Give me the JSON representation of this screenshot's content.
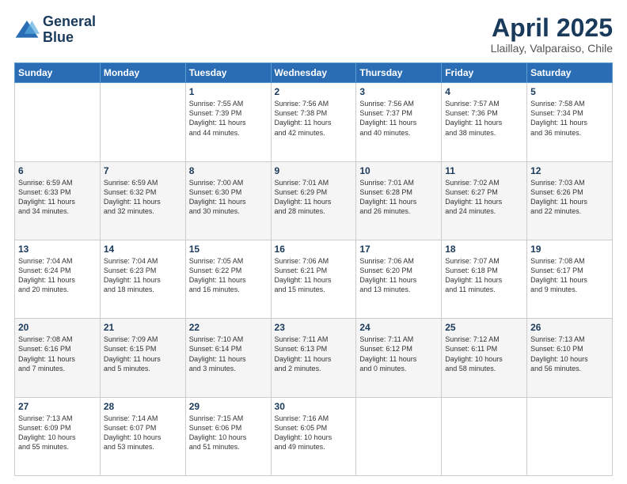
{
  "logo": {
    "line1": "General",
    "line2": "Blue"
  },
  "header": {
    "title": "April 2025",
    "subtitle": "Llaillay, Valparaiso, Chile"
  },
  "days_of_week": [
    "Sunday",
    "Monday",
    "Tuesday",
    "Wednesday",
    "Thursday",
    "Friday",
    "Saturday"
  ],
  "weeks": [
    [
      {
        "day": "",
        "info": ""
      },
      {
        "day": "",
        "info": ""
      },
      {
        "day": "1",
        "info": "Sunrise: 7:55 AM\nSunset: 7:39 PM\nDaylight: 11 hours\nand 44 minutes."
      },
      {
        "day": "2",
        "info": "Sunrise: 7:56 AM\nSunset: 7:38 PM\nDaylight: 11 hours\nand 42 minutes."
      },
      {
        "day": "3",
        "info": "Sunrise: 7:56 AM\nSunset: 7:37 PM\nDaylight: 11 hours\nand 40 minutes."
      },
      {
        "day": "4",
        "info": "Sunrise: 7:57 AM\nSunset: 7:36 PM\nDaylight: 11 hours\nand 38 minutes."
      },
      {
        "day": "5",
        "info": "Sunrise: 7:58 AM\nSunset: 7:34 PM\nDaylight: 11 hours\nand 36 minutes."
      }
    ],
    [
      {
        "day": "6",
        "info": "Sunrise: 6:59 AM\nSunset: 6:33 PM\nDaylight: 11 hours\nand 34 minutes."
      },
      {
        "day": "7",
        "info": "Sunrise: 6:59 AM\nSunset: 6:32 PM\nDaylight: 11 hours\nand 32 minutes."
      },
      {
        "day": "8",
        "info": "Sunrise: 7:00 AM\nSunset: 6:30 PM\nDaylight: 11 hours\nand 30 minutes."
      },
      {
        "day": "9",
        "info": "Sunrise: 7:01 AM\nSunset: 6:29 PM\nDaylight: 11 hours\nand 28 minutes."
      },
      {
        "day": "10",
        "info": "Sunrise: 7:01 AM\nSunset: 6:28 PM\nDaylight: 11 hours\nand 26 minutes."
      },
      {
        "day": "11",
        "info": "Sunrise: 7:02 AM\nSunset: 6:27 PM\nDaylight: 11 hours\nand 24 minutes."
      },
      {
        "day": "12",
        "info": "Sunrise: 7:03 AM\nSunset: 6:26 PM\nDaylight: 11 hours\nand 22 minutes."
      }
    ],
    [
      {
        "day": "13",
        "info": "Sunrise: 7:04 AM\nSunset: 6:24 PM\nDaylight: 11 hours\nand 20 minutes."
      },
      {
        "day": "14",
        "info": "Sunrise: 7:04 AM\nSunset: 6:23 PM\nDaylight: 11 hours\nand 18 minutes."
      },
      {
        "day": "15",
        "info": "Sunrise: 7:05 AM\nSunset: 6:22 PM\nDaylight: 11 hours\nand 16 minutes."
      },
      {
        "day": "16",
        "info": "Sunrise: 7:06 AM\nSunset: 6:21 PM\nDaylight: 11 hours\nand 15 minutes."
      },
      {
        "day": "17",
        "info": "Sunrise: 7:06 AM\nSunset: 6:20 PM\nDaylight: 11 hours\nand 13 minutes."
      },
      {
        "day": "18",
        "info": "Sunrise: 7:07 AM\nSunset: 6:18 PM\nDaylight: 11 hours\nand 11 minutes."
      },
      {
        "day": "19",
        "info": "Sunrise: 7:08 AM\nSunset: 6:17 PM\nDaylight: 11 hours\nand 9 minutes."
      }
    ],
    [
      {
        "day": "20",
        "info": "Sunrise: 7:08 AM\nSunset: 6:16 PM\nDaylight: 11 hours\nand 7 minutes."
      },
      {
        "day": "21",
        "info": "Sunrise: 7:09 AM\nSunset: 6:15 PM\nDaylight: 11 hours\nand 5 minutes."
      },
      {
        "day": "22",
        "info": "Sunrise: 7:10 AM\nSunset: 6:14 PM\nDaylight: 11 hours\nand 3 minutes."
      },
      {
        "day": "23",
        "info": "Sunrise: 7:11 AM\nSunset: 6:13 PM\nDaylight: 11 hours\nand 2 minutes."
      },
      {
        "day": "24",
        "info": "Sunrise: 7:11 AM\nSunset: 6:12 PM\nDaylight: 11 hours\nand 0 minutes."
      },
      {
        "day": "25",
        "info": "Sunrise: 7:12 AM\nSunset: 6:11 PM\nDaylight: 10 hours\nand 58 minutes."
      },
      {
        "day": "26",
        "info": "Sunrise: 7:13 AM\nSunset: 6:10 PM\nDaylight: 10 hours\nand 56 minutes."
      }
    ],
    [
      {
        "day": "27",
        "info": "Sunrise: 7:13 AM\nSunset: 6:09 PM\nDaylight: 10 hours\nand 55 minutes."
      },
      {
        "day": "28",
        "info": "Sunrise: 7:14 AM\nSunset: 6:07 PM\nDaylight: 10 hours\nand 53 minutes."
      },
      {
        "day": "29",
        "info": "Sunrise: 7:15 AM\nSunset: 6:06 PM\nDaylight: 10 hours\nand 51 minutes."
      },
      {
        "day": "30",
        "info": "Sunrise: 7:16 AM\nSunset: 6:05 PM\nDaylight: 10 hours\nand 49 minutes."
      },
      {
        "day": "",
        "info": ""
      },
      {
        "day": "",
        "info": ""
      },
      {
        "day": "",
        "info": ""
      }
    ]
  ]
}
